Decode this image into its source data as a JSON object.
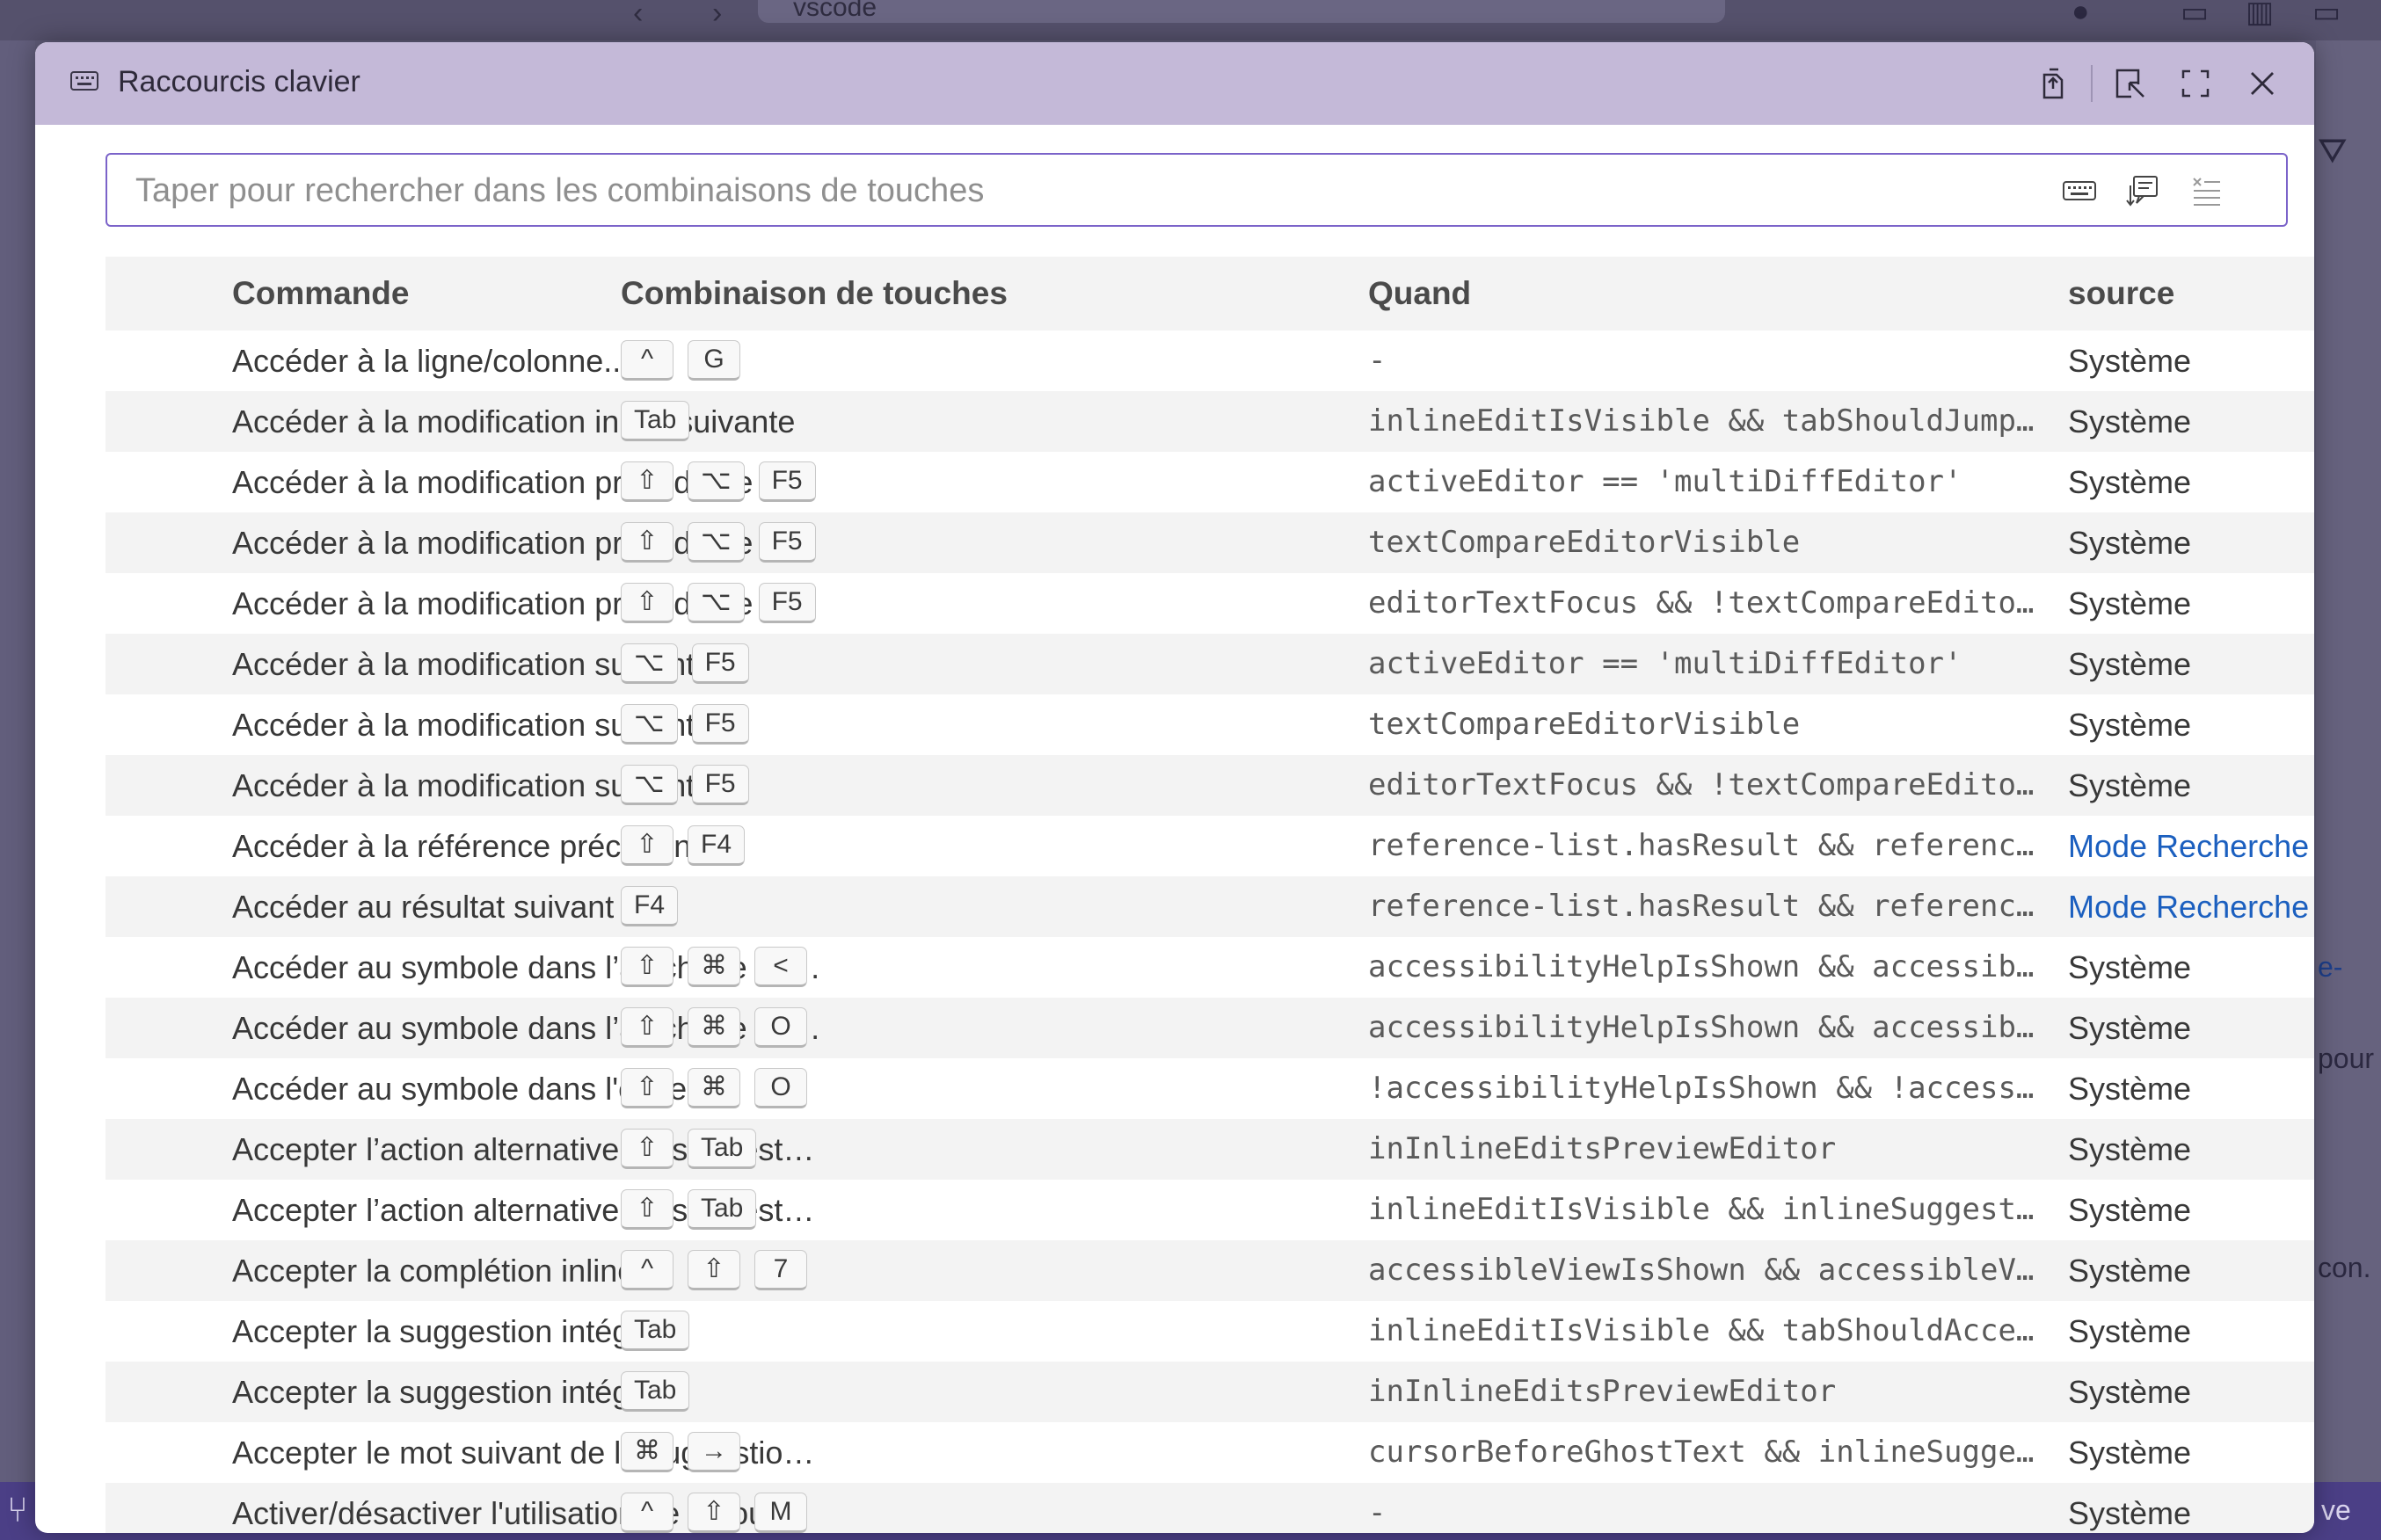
{
  "background": {
    "search_text": "vscode",
    "right_fragments": [
      "e-",
      "pour",
      "con.",
      "ve"
    ]
  },
  "dialog": {
    "title": "Raccourcis clavier",
    "search_placeholder": "Taper pour rechercher dans les combinaisons de touches",
    "search_value": ""
  },
  "columns": {
    "command": "Commande",
    "keybinding": "Combinaison de touches",
    "when": "Quand",
    "source": "source"
  },
  "rows": [
    {
      "command": "Accéder à la ligne/colonne...",
      "keys": [
        "^",
        "G"
      ],
      "when": "-",
      "source": "Système",
      "source_link": false
    },
    {
      "command": "Accéder à la modification inline suivante",
      "keys": [
        "Tab"
      ],
      "when": "inlineEditIsVisible && tabShouldJump…",
      "source": "Système",
      "source_link": false
    },
    {
      "command": "Accéder à la modification précédente",
      "keys": [
        "⇧",
        "⌥",
        "F5"
      ],
      "when": "activeEditor == 'multiDiffEditor'",
      "source": "Système",
      "source_link": false
    },
    {
      "command": "Accéder à la modification précédente",
      "keys": [
        "⇧",
        "⌥",
        "F5"
      ],
      "when": "textCompareEditorVisible",
      "source": "Système",
      "source_link": false
    },
    {
      "command": "Accéder à la modification précédente",
      "keys": [
        "⇧",
        "⌥",
        "F5"
      ],
      "when": "editorTextFocus && !textCompareEdito…",
      "source": "Système",
      "source_link": false
    },
    {
      "command": "Accéder à la modification suivante",
      "keys": [
        "⌥",
        "F5"
      ],
      "when": "activeEditor == 'multiDiffEditor'",
      "source": "Système",
      "source_link": false
    },
    {
      "command": "Accéder à la modification suivante",
      "keys": [
        "⌥",
        "F5"
      ],
      "when": "textCompareEditorVisible",
      "source": "Système",
      "source_link": false
    },
    {
      "command": "Accéder à la modification suivante",
      "keys": [
        "⌥",
        "F5"
      ],
      "when": "editorTextFocus && !textCompareEdito…",
      "source": "Système",
      "source_link": false
    },
    {
      "command": "Accéder à la référence précédente",
      "keys": [
        "⇧",
        "F4"
      ],
      "when": "reference-list.hasResult && referenc…",
      "source": "Mode Recherche c",
      "source_link": true
    },
    {
      "command": "Accéder au résultat suivant",
      "keys": [
        "F4"
      ],
      "when": "reference-list.hasResult && referenc…",
      "source": "Mode Recherche c",
      "source_link": true
    },
    {
      "command": "Accéder au symbole dans l’affichage ac…",
      "keys": [
        "⇧",
        "⌘",
        "<"
      ],
      "when": "accessibilityHelpIsShown && accessib…",
      "source": "Système",
      "source_link": false
    },
    {
      "command": "Accéder au symbole dans l’affichage ac…",
      "keys": [
        "⇧",
        "⌘",
        "O"
      ],
      "when": "accessibilityHelpIsShown && accessib…",
      "source": "Système",
      "source_link": false
    },
    {
      "command": "Accéder au symbole dans l'éditeur...",
      "keys": [
        "⇧",
        "⌘",
        "O"
      ],
      "when": "!accessibilityHelpIsShown && !access…",
      "source": "Système",
      "source_link": false
    },
    {
      "command": "Accepter l’action alternative de suggest…",
      "keys": [
        "⇧",
        "Tab"
      ],
      "when": "inInlineEditsPreviewEditor",
      "source": "Système",
      "source_link": false
    },
    {
      "command": "Accepter l’action alternative de suggest…",
      "keys": [
        "⇧",
        "Tab"
      ],
      "when": "inlineEditIsVisible && inlineSuggest…",
      "source": "Système",
      "source_link": false
    },
    {
      "command": "Accepter la complétion inline",
      "keys": [
        "^",
        "⇧",
        "7"
      ],
      "when": "accessibleViewIsShown && accessibleV…",
      "source": "Système",
      "source_link": false
    },
    {
      "command": "Accepter la suggestion intégrée",
      "keys": [
        "Tab"
      ],
      "when": "inlineEditIsVisible && tabShouldAcce…",
      "source": "Système",
      "source_link": false
    },
    {
      "command": "Accepter la suggestion intégrée",
      "keys": [
        "Tab"
      ],
      "when": "inInlineEditsPreviewEditor",
      "source": "Système",
      "source_link": false
    },
    {
      "command": "Accepter le mot suivant de la suggestio…",
      "keys": [
        "⌘",
        "→"
      ],
      "when": "cursorBeforeGhostText && inlineSugge…",
      "source": "Système",
      "source_link": false
    },
    {
      "command": "Activer/désactiver l'utilisation de la tou…",
      "keys": [
        "^",
        "⇧",
        "M"
      ],
      "when": "-",
      "source": "Système",
      "source_link": false
    }
  ]
}
